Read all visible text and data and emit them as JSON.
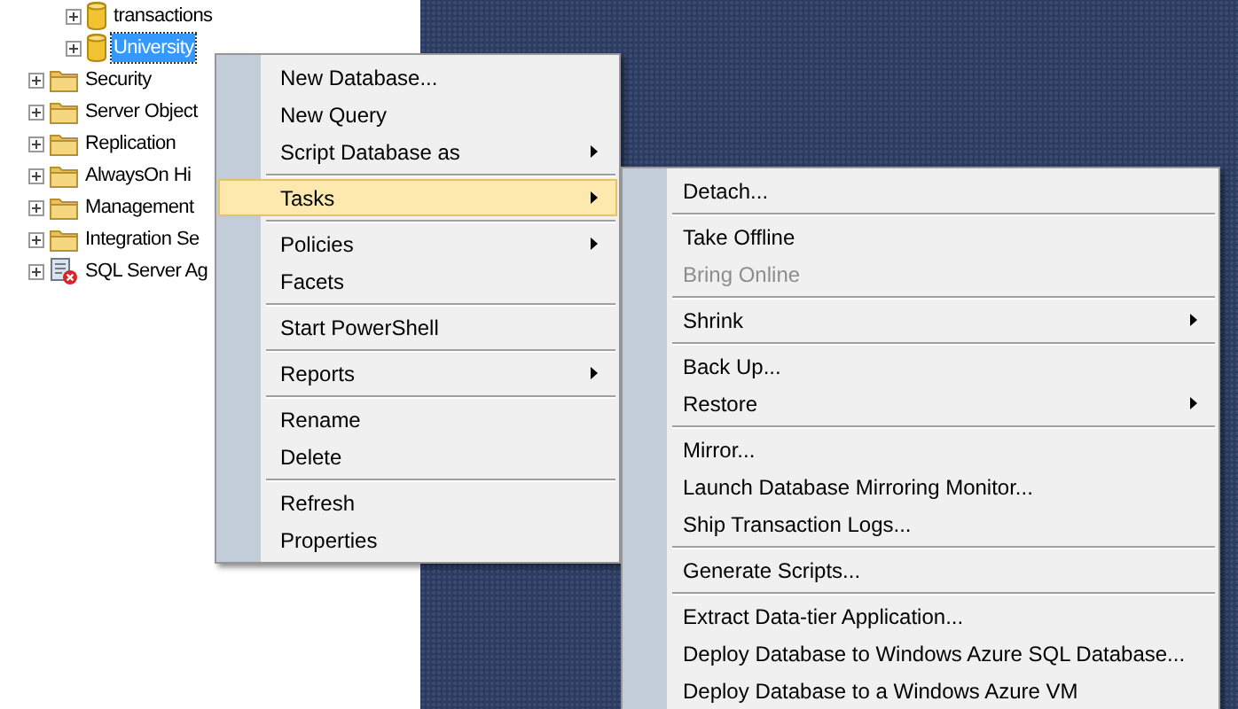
{
  "tree": {
    "databases": [
      {
        "label": "transactions",
        "kind": "database",
        "selected": false
      },
      {
        "label": "University",
        "kind": "database",
        "selected": true
      }
    ],
    "nodes": [
      {
        "label": "Security",
        "kind": "folder",
        "selected": false
      },
      {
        "label": "Server Object",
        "kind": "folder",
        "selected": false
      },
      {
        "label": "Replication",
        "kind": "folder",
        "selected": false
      },
      {
        "label": "AlwaysOn Hi",
        "kind": "folder",
        "selected": false
      },
      {
        "label": "Management",
        "kind": "folder",
        "selected": false
      },
      {
        "label": "Integration Se",
        "kind": "folder",
        "selected": false
      },
      {
        "label": "SQL Server Ag",
        "kind": "agent",
        "selected": false
      }
    ]
  },
  "context_menu": {
    "items": [
      {
        "kind": "item",
        "label": "New Database...",
        "submenu": false,
        "selected": false,
        "disabled": false
      },
      {
        "kind": "item",
        "label": "New Query",
        "submenu": false,
        "selected": false,
        "disabled": false
      },
      {
        "kind": "item",
        "label": "Script Database as",
        "submenu": true,
        "selected": false,
        "disabled": false
      },
      {
        "kind": "separator"
      },
      {
        "kind": "item",
        "label": "Tasks",
        "submenu": true,
        "selected": true,
        "disabled": false
      },
      {
        "kind": "separator"
      },
      {
        "kind": "item",
        "label": "Policies",
        "submenu": true,
        "selected": false,
        "disabled": false
      },
      {
        "kind": "item",
        "label": "Facets",
        "submenu": false,
        "selected": false,
        "disabled": false
      },
      {
        "kind": "separator"
      },
      {
        "kind": "item",
        "label": "Start PowerShell",
        "submenu": false,
        "selected": false,
        "disabled": false
      },
      {
        "kind": "separator"
      },
      {
        "kind": "item",
        "label": "Reports",
        "submenu": true,
        "selected": false,
        "disabled": false
      },
      {
        "kind": "separator"
      },
      {
        "kind": "item",
        "label": "Rename",
        "submenu": false,
        "selected": false,
        "disabled": false
      },
      {
        "kind": "item",
        "label": "Delete",
        "submenu": false,
        "selected": false,
        "disabled": false
      },
      {
        "kind": "separator"
      },
      {
        "kind": "item",
        "label": "Refresh",
        "submenu": false,
        "selected": false,
        "disabled": false
      },
      {
        "kind": "item",
        "label": "Properties",
        "submenu": false,
        "selected": false,
        "disabled": false
      }
    ]
  },
  "tasks_submenu": {
    "items": [
      {
        "kind": "item",
        "label": "Detach...",
        "submenu": false,
        "selected": false,
        "disabled": false
      },
      {
        "kind": "separator"
      },
      {
        "kind": "item",
        "label": "Take Offline",
        "submenu": false,
        "selected": false,
        "disabled": false
      },
      {
        "kind": "item",
        "label": "Bring Online",
        "submenu": false,
        "selected": false,
        "disabled": true
      },
      {
        "kind": "separator"
      },
      {
        "kind": "item",
        "label": "Shrink",
        "submenu": true,
        "selected": false,
        "disabled": false
      },
      {
        "kind": "separator"
      },
      {
        "kind": "item",
        "label": "Back Up...",
        "submenu": false,
        "selected": false,
        "disabled": false
      },
      {
        "kind": "item",
        "label": "Restore",
        "submenu": true,
        "selected": false,
        "disabled": false
      },
      {
        "kind": "separator"
      },
      {
        "kind": "item",
        "label": "Mirror...",
        "submenu": false,
        "selected": false,
        "disabled": false
      },
      {
        "kind": "item",
        "label": "Launch Database Mirroring Monitor...",
        "submenu": false,
        "selected": false,
        "disabled": false
      },
      {
        "kind": "item",
        "label": "Ship Transaction Logs...",
        "submenu": false,
        "selected": false,
        "disabled": false
      },
      {
        "kind": "separator"
      },
      {
        "kind": "item",
        "label": "Generate Scripts...",
        "submenu": false,
        "selected": false,
        "disabled": false
      },
      {
        "kind": "separator"
      },
      {
        "kind": "item",
        "label": "Extract Data-tier Application...",
        "submenu": false,
        "selected": false,
        "disabled": false
      },
      {
        "kind": "item",
        "label": "Deploy Database to Windows Azure SQL Database...",
        "submenu": false,
        "selected": false,
        "disabled": false
      },
      {
        "kind": "item",
        "label": "Deploy Database to a Windows Azure VM",
        "submenu": false,
        "selected": false,
        "disabled": false
      }
    ]
  }
}
